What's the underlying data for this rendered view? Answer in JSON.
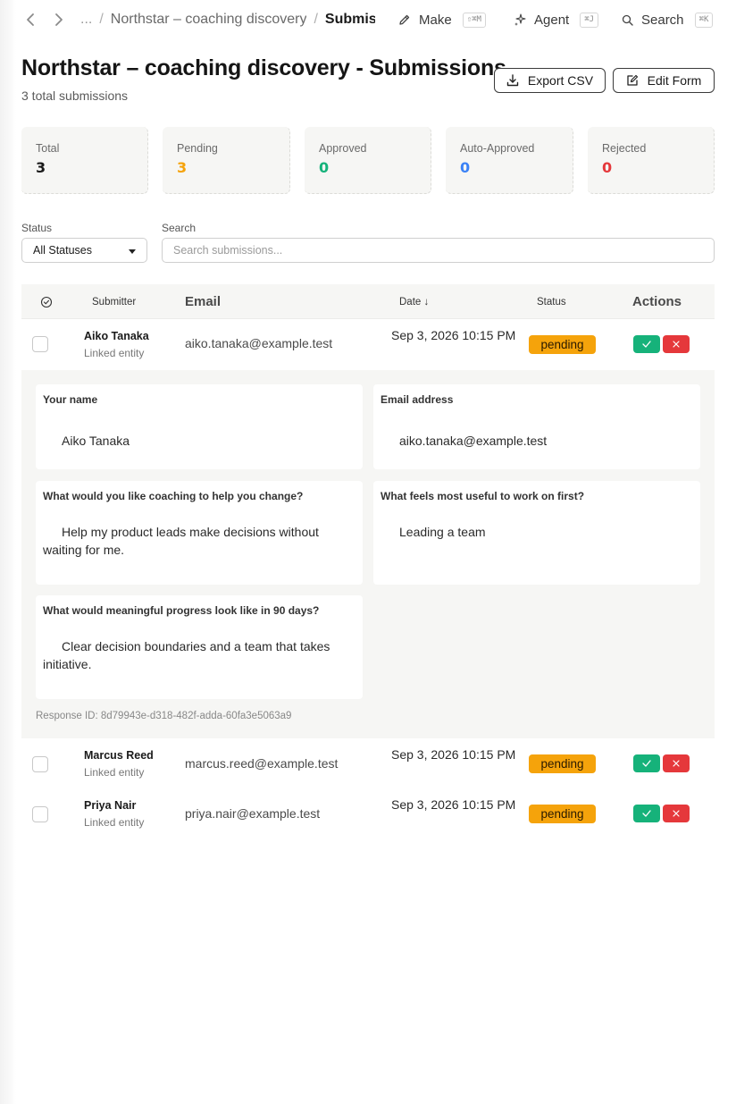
{
  "breadcrumb": {
    "ellipsis": "...",
    "parent": "Northstar – coaching discovery",
    "current": "Submissions"
  },
  "toolbar": {
    "make_label": "Make",
    "make_shortcut": "⇧⌘M",
    "agent_label": "Agent",
    "agent_shortcut": "⌘J",
    "search_label": "Search",
    "search_shortcut": "⌘K"
  },
  "header": {
    "title": "Northstar – coaching discovery - Submissions",
    "subtitle": "3 total submissions",
    "export_label": "Export CSV",
    "edit_label": "Edit Form"
  },
  "stats": [
    {
      "label": "Total",
      "value": "3",
      "color": "#1a1a1a"
    },
    {
      "label": "Pending",
      "value": "3",
      "color": "#f5a30b"
    },
    {
      "label": "Approved",
      "value": "0",
      "color": "#16b27a"
    },
    {
      "label": "Auto-Approved",
      "value": "0",
      "color": "#3b82f6"
    },
    {
      "label": "Rejected",
      "value": "0",
      "color": "#e5383b"
    }
  ],
  "filters": {
    "status_label": "Status",
    "status_value": "All Statuses",
    "search_label": "Search",
    "search_placeholder": "Search submissions..."
  },
  "table": {
    "headers": {
      "submitter": "Submitter",
      "email": "Email",
      "date": "Date ↓",
      "status": "Status",
      "actions": "Actions"
    },
    "rows": [
      {
        "name": "Aiko Tanaka",
        "entity": "Linked entity",
        "email": "aiko.tanaka@example.test",
        "date": "Sep 3, 2026 10:15 PM",
        "status": "pending"
      },
      {
        "name": "Marcus Reed",
        "entity": "Linked entity",
        "email": "marcus.reed@example.test",
        "date": "Sep 3, 2026 10:15 PM",
        "status": "pending"
      },
      {
        "name": "Priya Nair",
        "entity": "Linked entity",
        "email": "priya.nair@example.test",
        "date": "Sep 3, 2026 10:15 PM",
        "status": "pending"
      }
    ]
  },
  "expanded": {
    "fields": [
      {
        "label": "Your name",
        "value": "Aiko Tanaka"
      },
      {
        "label": "Email address",
        "value": "aiko.tanaka@example.test"
      },
      {
        "label": "What would you like coaching to help you change?",
        "value": "Help my product leads make decisions without waiting for me."
      },
      {
        "label": "What feels most useful to work on first?",
        "value": "Leading a team"
      },
      {
        "label": "What would meaningful progress look like in 90 days?",
        "value": "Clear decision boundaries and a team that takes initiative."
      }
    ],
    "response_id": "Response ID: 8d79943e-d318-482f-adda-60fa3e5063a9"
  },
  "colors": {
    "pending": "#f5a30b",
    "approve": "#16b27a",
    "reject": "#e5383b"
  }
}
